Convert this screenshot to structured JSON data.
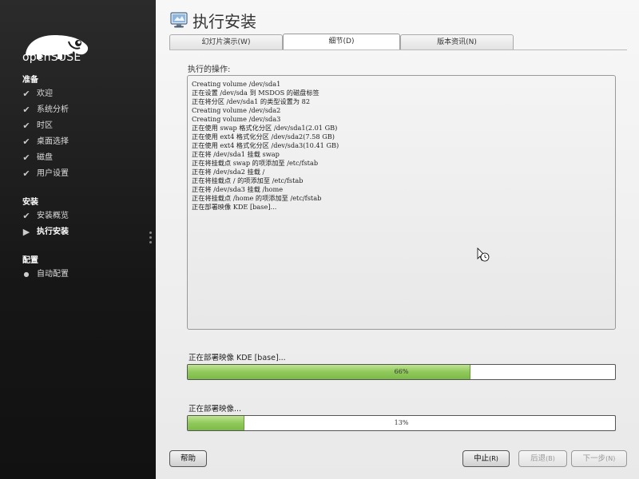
{
  "brand": {
    "logo_text": "openSUSE",
    "accent": "#7cba47"
  },
  "sidebar": {
    "sections": [
      {
        "title": "准备",
        "items": [
          {
            "label": "欢迎",
            "state": "done"
          },
          {
            "label": "系统分析",
            "state": "done"
          },
          {
            "label": "时区",
            "state": "done"
          },
          {
            "label": "桌面选择",
            "state": "done"
          },
          {
            "label": "磁盘",
            "state": "done"
          },
          {
            "label": "用户设置",
            "state": "done"
          }
        ]
      },
      {
        "title": "安装",
        "items": [
          {
            "label": "安装概览",
            "state": "done"
          },
          {
            "label": "执行安装",
            "state": "current"
          }
        ]
      },
      {
        "title": "配置",
        "items": [
          {
            "label": "自动配置",
            "state": "pending"
          }
        ]
      }
    ]
  },
  "header": {
    "title": "执行安装",
    "icon": "monitor-icon"
  },
  "tabs": [
    {
      "label": "幻灯片演示",
      "key": "W",
      "active": false
    },
    {
      "label": "细节",
      "key": "D",
      "active": true
    },
    {
      "label": "版本资讯",
      "key": "N",
      "active": false
    }
  ],
  "details": {
    "label": "执行的操作:",
    "log": [
      "Creating volume /dev/sda1",
      "正在设置 /dev/sda 到 MSDOS 的磁盘标签",
      "正在将分区 /dev/sda1 的类型设置为 82",
      "Creating volume /dev/sda2",
      "Creating volume /dev/sda3",
      "正在使用 swap 格式化分区 /dev/sda1(2.01 GB)",
      "正在使用 ext4 格式化分区 /dev/sda2(7.58 GB)",
      "正在使用 ext4 格式化分区 /dev/sda3(10.41 GB)",
      "正在将 /dev/sda1 挂载 swap",
      "正在将挂载点 swap 的项添加至 /etc/fstab",
      "正在将 /dev/sda2 挂载 /",
      "正在将挂载点 / 的项添加至 /etc/fstab",
      "正在将 /dev/sda3 挂载 /home",
      "正在将挂载点 /home 的项添加至 /etc/fstab",
      "正在部署映像 KDE [base]..."
    ]
  },
  "progress": [
    {
      "label": "正在部署映像 KDE [base]...",
      "percent": 66,
      "text": "66%"
    },
    {
      "label": "正在部署映像...",
      "percent": 13,
      "text": "13%"
    }
  ],
  "buttons": {
    "help": {
      "label": "帮助",
      "key": ""
    },
    "abort": {
      "label": "中止",
      "key": "(R)"
    },
    "back": {
      "label": "后退",
      "key": "(B)"
    },
    "next": {
      "label": "下一步",
      "key": "(N)"
    }
  }
}
